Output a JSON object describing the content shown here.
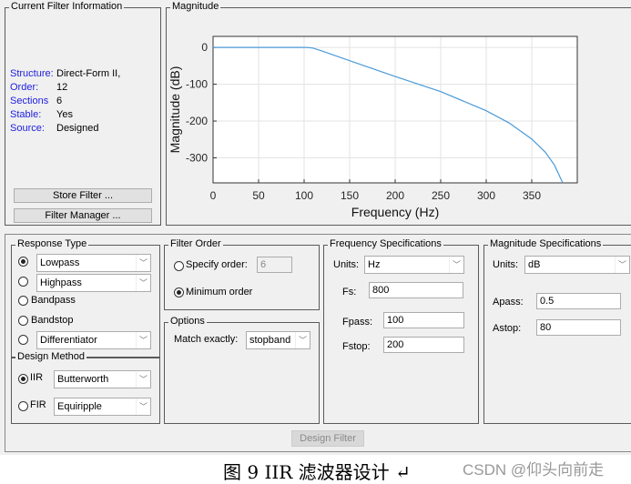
{
  "info": {
    "title": "Current Filter Information",
    "rows": [
      {
        "label": "Structure:",
        "value": "Direct-Form II,"
      },
      {
        "label": "Order:",
        "value": "12"
      },
      {
        "label": "Sections",
        "value": "6"
      },
      {
        "label": "Stable:",
        "value": "Yes"
      },
      {
        "label": "Source:",
        "value": "Designed"
      }
    ],
    "store_label": "Store Filter ...",
    "manager_label": "Filter Manager ..."
  },
  "plot": {
    "title": "Magnitude"
  },
  "chart_data": {
    "type": "line",
    "xlabel": "Frequency (Hz)",
    "ylabel": "Magnitude (dB)",
    "xlim": [
      0,
      400
    ],
    "ylim": [
      -368,
      30
    ],
    "xticks": [
      "0",
      "50",
      "100",
      "150",
      "200",
      "250",
      "300",
      "350"
    ],
    "yticks": [
      "0",
      "-100",
      "-200",
      "-300"
    ],
    "grid": true,
    "color": "#4a9ad8",
    "x": [
      0,
      50,
      100,
      105,
      110,
      120,
      150,
      200,
      250,
      300,
      325,
      350,
      365,
      375,
      384
    ],
    "y": [
      0,
      0,
      0,
      -0.5,
      -2,
      -10,
      -36,
      -79,
      -120,
      -172,
      -205,
      -249,
      -285,
      -320,
      -368
    ]
  },
  "response_type": {
    "title": "Response Type",
    "lowpass": "Lowpass",
    "highpass": "Highpass",
    "bandpass": "Bandpass",
    "bandstop": "Bandstop",
    "differentiator": "Differentiator"
  },
  "design_method": {
    "title": "Design Method",
    "iir": "IIR",
    "iir_value": "Butterworth",
    "fir": "FIR",
    "fir_value": "Equiripple"
  },
  "filter_order": {
    "title": "Filter Order",
    "specify": "Specify order:",
    "specify_value": "6",
    "minimum": "Minimum order"
  },
  "options": {
    "title": "Options",
    "match_label": "Match exactly:",
    "match_value": "stopband"
  },
  "freq": {
    "title": "Frequency Specifications",
    "units_label": "Units:",
    "units": "Hz",
    "fs_label": "Fs:",
    "fs": "800",
    "fpass_label": "Fpass:",
    "fpass": "100",
    "fstop_label": "Fstop:",
    "fstop": "200"
  },
  "mag": {
    "title": "Magnitude Specifications",
    "units_label": "Units:",
    "units": "dB",
    "apass_label": "Apass:",
    "apass": "0.5",
    "astop_label": "Astop:",
    "astop": "80"
  },
  "design_label": "Design Filter",
  "caption": "图 9 IIR 滤波器设计 ↵",
  "watermark": "CSDN @仰头向前走"
}
